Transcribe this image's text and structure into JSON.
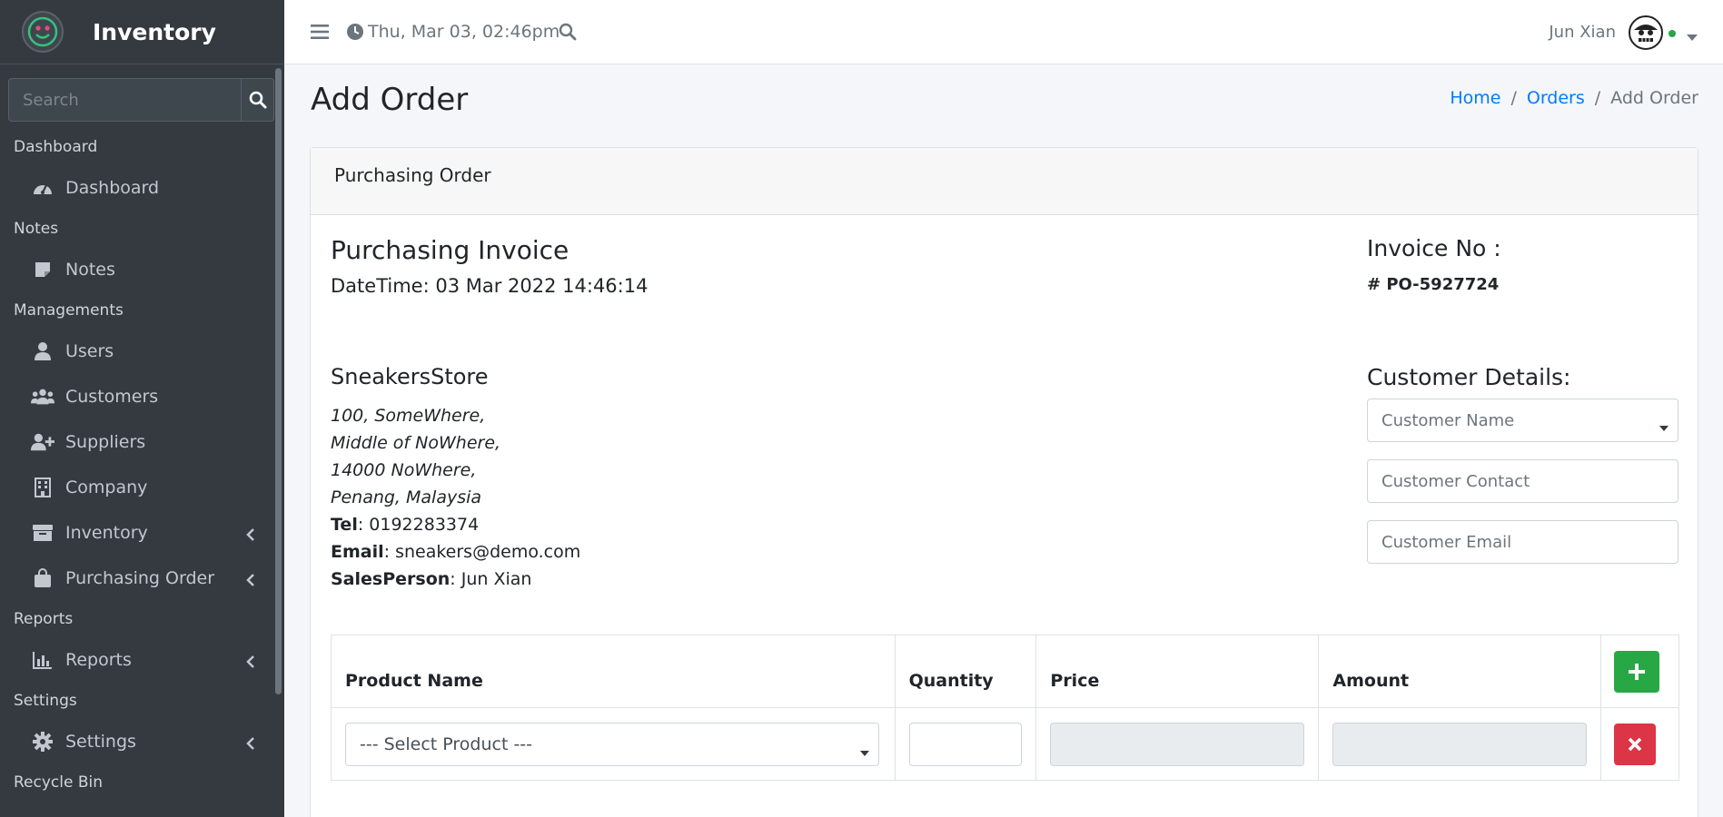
{
  "sidebar": {
    "brand": "Inventory",
    "search_placeholder": "Search",
    "sections": [
      {
        "header": "Dashboard",
        "items": [
          {
            "label": "Dashboard",
            "icon": "tachometer-icon"
          }
        ]
      },
      {
        "header": "Notes",
        "items": [
          {
            "label": "Notes",
            "icon": "note-icon"
          }
        ]
      },
      {
        "header": "Managements",
        "items": [
          {
            "label": "Users",
            "icon": "user-icon"
          },
          {
            "label": "Customers",
            "icon": "users-icon"
          },
          {
            "label": "Suppliers",
            "icon": "user-plus-icon"
          },
          {
            "label": "Company",
            "icon": "building-icon"
          },
          {
            "label": "Inventory",
            "icon": "box-icon"
          },
          {
            "label": "Purchasing Order",
            "icon": "shopping-bag-icon"
          }
        ]
      },
      {
        "header": "Reports",
        "items": [
          {
            "label": "Reports",
            "icon": "chart-icon"
          }
        ]
      },
      {
        "header": "Settings",
        "items": [
          {
            "label": "Settings",
            "icon": "gear-icon"
          }
        ]
      },
      {
        "header": "Recycle Bin",
        "items": []
      }
    ]
  },
  "topbar": {
    "datetime": "Thu, Mar 03, 02:46pm",
    "user_name": "Jun Xian"
  },
  "page": {
    "title": "Add Order",
    "breadcrumb": [
      "Home",
      "Orders",
      "Add Order"
    ]
  },
  "card": {
    "header": "Purchasing Order",
    "invoice_title": "Purchasing Invoice",
    "datetime": "DateTime: 03 Mar 2022 14:46:14",
    "invoice_no_label": "Invoice No :",
    "invoice_no_value": "# PO-5927724",
    "store": {
      "name": "SneakersStore",
      "address_lines": [
        "100, SomeWhere,",
        "Middle of NoWhere,",
        "14000 NoWhere,",
        "Penang, Malaysia"
      ],
      "tel_label": "Tel",
      "tel": ": 0192283374",
      "email_label": "Email",
      "email": ": sneakers@demo.com",
      "salesperson_label": "SalesPerson",
      "salesperson": ": Jun Xian"
    },
    "customer": {
      "title": "Customer Details:",
      "name_placeholder": "Customer Name",
      "contact_placeholder": "Customer Contact",
      "email_placeholder": "Customer Email"
    },
    "table": {
      "columns": [
        "Product Name",
        "Quantity",
        "Price",
        "Amount"
      ],
      "product_select": "--- Select Product ---"
    }
  },
  "colors": {
    "sidebar": "#343a40",
    "accent": "#007bff",
    "add": "#28a745",
    "delete": "#dc3545"
  }
}
